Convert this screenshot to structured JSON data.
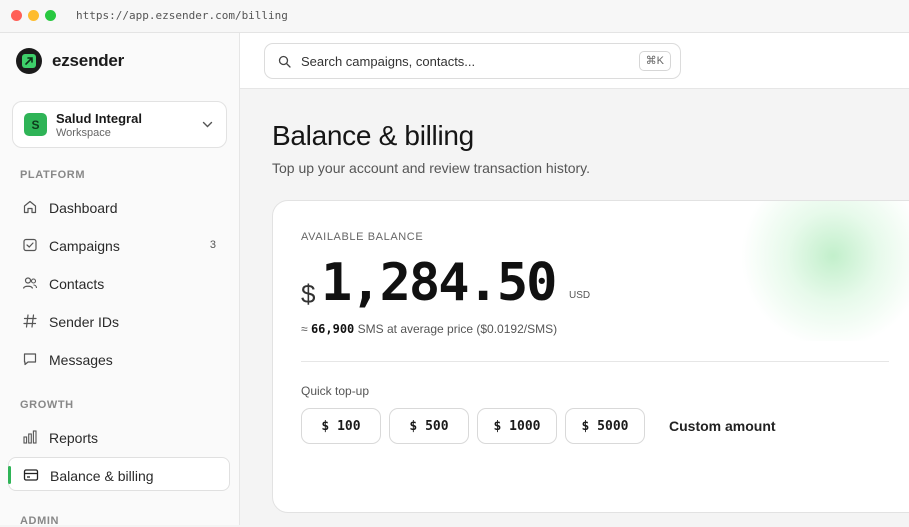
{
  "browser": {
    "url": "https://app.ezsender.com/billing"
  },
  "brand": {
    "name": "ezsender"
  },
  "workspace": {
    "name": "Salud Integral",
    "subtitle": "Workspace",
    "initial": "S"
  },
  "sidebar": {
    "sections": [
      {
        "label": "PLATFORM",
        "items": [
          {
            "label": "Dashboard",
            "icon": "home-icon"
          },
          {
            "label": "Campaigns",
            "icon": "checkbox-icon",
            "count": "3"
          },
          {
            "label": "Contacts",
            "icon": "users-icon"
          },
          {
            "label": "Sender IDs",
            "icon": "hash-icon"
          },
          {
            "label": "Messages",
            "icon": "message-icon"
          }
        ]
      },
      {
        "label": "GROWTH",
        "items": [
          {
            "label": "Reports",
            "icon": "bar-chart-icon"
          },
          {
            "label": "Balance & billing",
            "icon": "card-icon",
            "active": true
          }
        ]
      },
      {
        "label": "ADMIN",
        "items": []
      }
    ]
  },
  "search": {
    "placeholder": "Search campaigns, contacts...",
    "shortcut": "⌘K"
  },
  "page": {
    "title": "Balance & billing",
    "subtitle": "Top up your account and review transaction history."
  },
  "balance": {
    "label": "AVAILABLE BALANCE",
    "currency_symbol": "$",
    "amount": "1,284.50",
    "unit": "USD",
    "approx_prefix": "≈",
    "approx_sms": "66,900",
    "approx_suffix": "SMS at average price ($0.0192/SMS)"
  },
  "topup": {
    "label": "Quick top-up",
    "amounts": [
      "$ 100",
      "$ 500",
      "$ 1000",
      "$ 5000"
    ],
    "custom_label": "Custom amount"
  },
  "colors": {
    "accent": "#2fb457",
    "glow": "#b8efc5"
  }
}
